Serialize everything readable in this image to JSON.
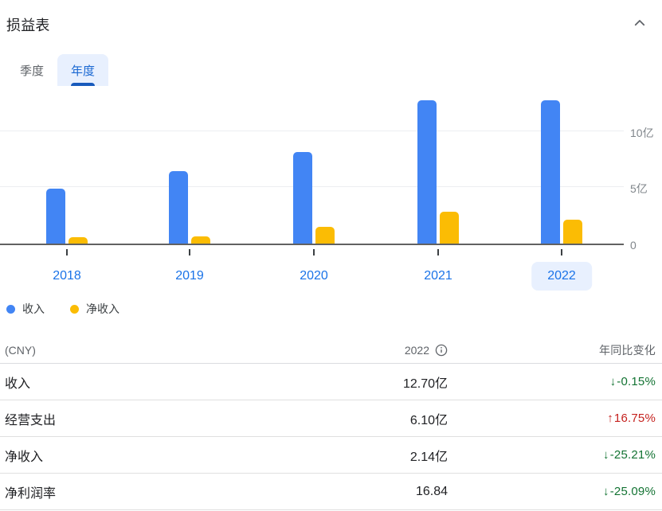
{
  "panel": {
    "title": "损益表"
  },
  "tabs": [
    {
      "label": "季度",
      "active": false
    },
    {
      "label": "年度",
      "active": true
    }
  ],
  "chart_data": {
    "type": "bar",
    "title": "损益表 年度图",
    "categories": [
      "2018",
      "2019",
      "2020",
      "2021",
      "2022"
    ],
    "series": [
      {
        "name": "收入",
        "color": "#4285f4",
        "values": [
          4.85,
          6.45,
          8.15,
          12.72,
          12.7
        ]
      },
      {
        "name": "净收入",
        "color": "#fbbc04",
        "values": [
          0.55,
          0.62,
          1.49,
          2.86,
          2.14
        ]
      }
    ],
    "unit": "亿",
    "currency": "CNY",
    "ylim": [
      0,
      14.1
    ],
    "y_ticks": [
      {
        "value": 0,
        "label": "0"
      },
      {
        "value": 5,
        "label": "5亿"
      },
      {
        "value": 10,
        "label": "10亿"
      }
    ],
    "grid": true,
    "legend_position": "bottom-left",
    "selected_category": "2022"
  },
  "legend": [
    {
      "label": "收入",
      "color": "#4285f4"
    },
    {
      "label": "净收入",
      "color": "#fbbc04"
    }
  ],
  "table": {
    "header": {
      "col1": "(CNY)",
      "col2": "2022",
      "col3": "年同比变化"
    },
    "rows": [
      {
        "label": "收入",
        "value": "12.70亿",
        "arrow": "↓",
        "change": "-0.15%",
        "direction": "down"
      },
      {
        "label": "经营支出",
        "value": "6.10亿",
        "arrow": "↑",
        "change": "16.75%",
        "direction": "up"
      },
      {
        "label": "净收入",
        "value": "2.14亿",
        "arrow": "↓",
        "change": "-25.21%",
        "direction": "down"
      },
      {
        "label": "净利润率",
        "value": "16.84",
        "arrow": "↓",
        "change": "-25.09%",
        "direction": "down"
      }
    ]
  },
  "colors": {
    "up": "#c5221f",
    "down": "#137333",
    "axis_label": "#80868b",
    "accent_blue": "#1a73e8",
    "tab_bg": "#e8f0fe"
  }
}
